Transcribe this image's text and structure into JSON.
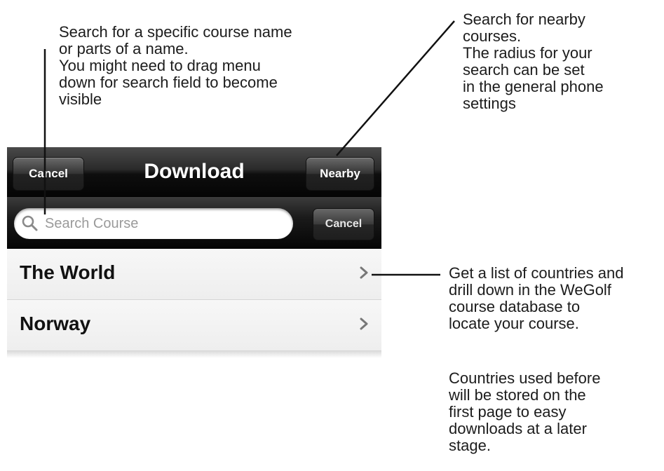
{
  "annotations": {
    "search": "Search for a specific course name\nor parts of a name.\nYou might need to drag menu\ndown for search field to become\nvisible",
    "nearby": "Search for nearby\ncourses.\nThe radius for your\nsearch can be set\nin the general phone\nsettings",
    "list": "Get a list of countries and\ndrill down in the WeGolf\ncourse database to\nlocate your course.",
    "stored": "Countries used before\nwill be stored on the\nfirst page to easy\ndownloads at a later\nstage."
  },
  "navbar": {
    "title": "Download",
    "left_button": "Cancel",
    "right_button": "Nearby"
  },
  "search": {
    "placeholder": "Search Course",
    "cancel_button": "Cancel"
  },
  "list": {
    "items": [
      {
        "label": "The World",
        "icon": "chevron-right-icon"
      },
      {
        "label": "Norway",
        "icon": "chevron-right-icon"
      }
    ]
  }
}
